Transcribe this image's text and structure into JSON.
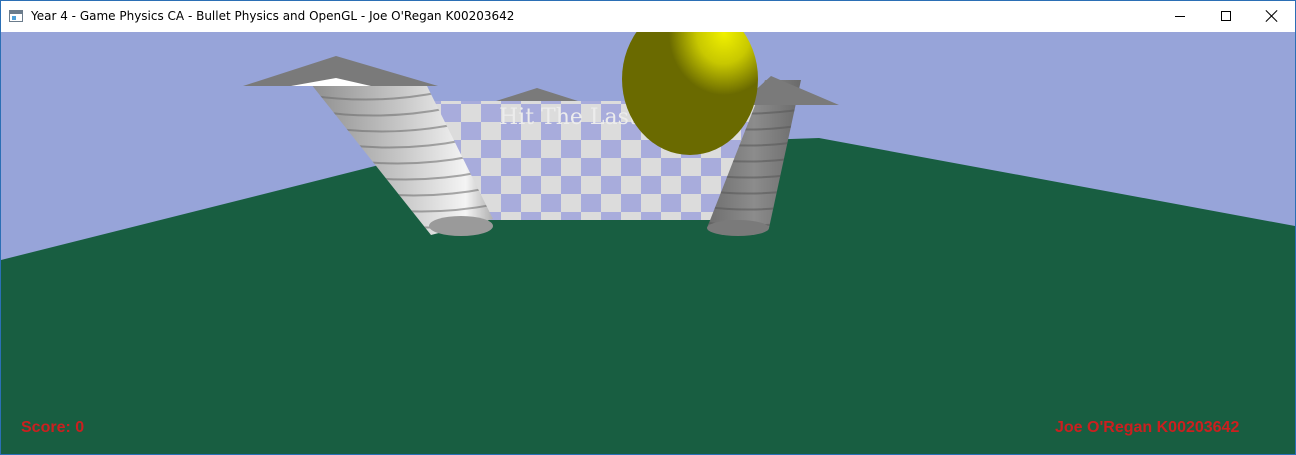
{
  "window": {
    "title": "Year 4 - Game Physics CA - Bullet Physics and OpenGL - Joe O'Regan K00203642",
    "app_icon": "application-window-icon",
    "controls": {
      "minimize_icon": "minimize-icon",
      "maximize_icon": "maximize-icon",
      "close_icon": "close-icon"
    }
  },
  "scene": {
    "colors": {
      "sky": "#97a4d9",
      "ground": "#185e41",
      "checker_light": "#dcdcdc",
      "checker_dark": "#a8acdc",
      "ball": "#6a6a00",
      "ball_highlight": "#e8e800",
      "arrow_cap": "#7a7a7a"
    },
    "board_text": "Hit The Last"
  },
  "hud": {
    "score_text": "Score: 0",
    "author_text": "Joe O'Regan K00203642",
    "text_color": "#cc1f1f"
  }
}
